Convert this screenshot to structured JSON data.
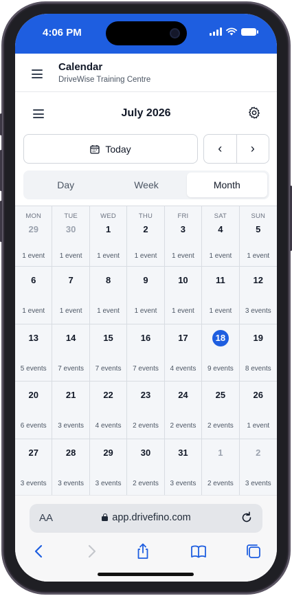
{
  "status_bar": {
    "time": "4:06 PM"
  },
  "app_header": {
    "title": "Calendar",
    "subtitle": "DriveWise Training Centre"
  },
  "calendar": {
    "month_label": "July 2026",
    "today_label": "Today",
    "prev_label": "‹",
    "next_label": "›",
    "views": [
      "Day",
      "Week",
      "Month"
    ],
    "active_view": "Month",
    "weekdays": [
      "MON",
      "TUE",
      "WED",
      "THU",
      "FRI",
      "SAT",
      "SUN"
    ],
    "today_date": "18",
    "weeks": [
      [
        {
          "day": "29",
          "events": "1 event",
          "muted": true
        },
        {
          "day": "30",
          "events": "1 event",
          "muted": true
        },
        {
          "day": "1",
          "events": "1 event"
        },
        {
          "day": "2",
          "events": "1 event"
        },
        {
          "day": "3",
          "events": "1 event"
        },
        {
          "day": "4",
          "events": "1 event"
        },
        {
          "day": "5",
          "events": "1 event"
        }
      ],
      [
        {
          "day": "6",
          "events": "1 event"
        },
        {
          "day": "7",
          "events": "1 event"
        },
        {
          "day": "8",
          "events": "1 event"
        },
        {
          "day": "9",
          "events": "1 event"
        },
        {
          "day": "10",
          "events": "1 event"
        },
        {
          "day": "11",
          "events": "1 event"
        },
        {
          "day": "12",
          "events": "3 events"
        }
      ],
      [
        {
          "day": "13",
          "events": "5 events"
        },
        {
          "day": "14",
          "events": "7 events"
        },
        {
          "day": "15",
          "events": "7 events"
        },
        {
          "day": "16",
          "events": "7 events"
        },
        {
          "day": "17",
          "events": "4 events"
        },
        {
          "day": "18",
          "events": "9 events",
          "today": true
        },
        {
          "day": "19",
          "events": "8 events"
        }
      ],
      [
        {
          "day": "20",
          "events": "6 events"
        },
        {
          "day": "21",
          "events": "3 events"
        },
        {
          "day": "22",
          "events": "4 events"
        },
        {
          "day": "23",
          "events": "2 events"
        },
        {
          "day": "24",
          "events": "2 events"
        },
        {
          "day": "25",
          "events": "2 events"
        },
        {
          "day": "26",
          "events": "1 event"
        }
      ],
      [
        {
          "day": "27",
          "events": "3 events"
        },
        {
          "day": "28",
          "events": "3 events"
        },
        {
          "day": "29",
          "events": "3 events"
        },
        {
          "day": "30",
          "events": "2 events"
        },
        {
          "day": "31",
          "events": "3 events"
        },
        {
          "day": "1",
          "events": "2 events",
          "muted": true
        },
        {
          "day": "2",
          "events": "3 events",
          "muted": true
        }
      ]
    ]
  },
  "browser": {
    "aa_label": "AA",
    "url": "app.drivefino.com"
  },
  "colors": {
    "accent": "#1e5ee0",
    "cell_bg": "#f4f6f9",
    "grid_line": "#d8dce2"
  },
  "icons": [
    "hamburger-icon",
    "gear-icon",
    "calendar-icon",
    "lock-icon",
    "reload-icon",
    "back-icon",
    "forward-icon",
    "share-icon",
    "bookmarks-icon",
    "tabs-icon"
  ]
}
